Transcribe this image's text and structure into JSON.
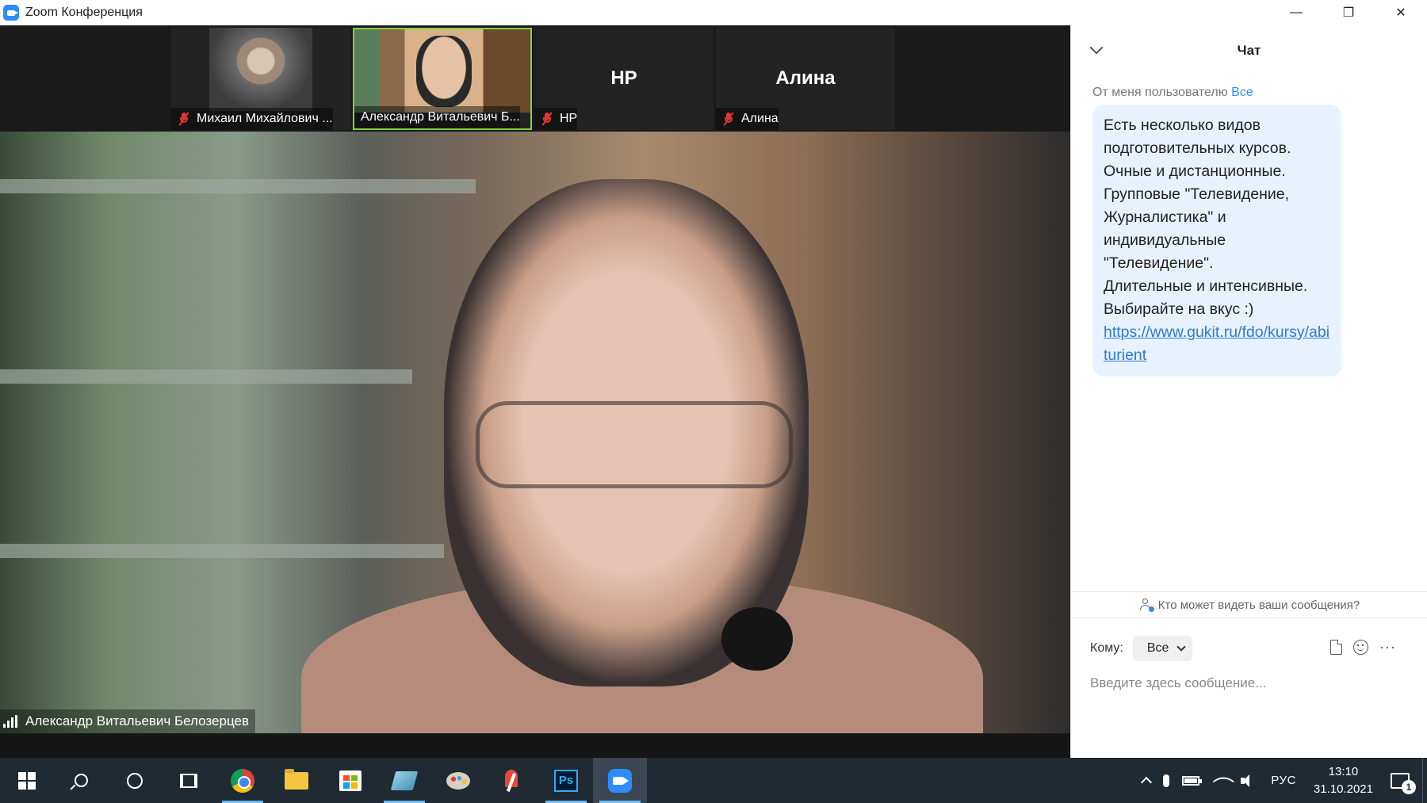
{
  "window": {
    "title": "Zoom Конференция",
    "controls": {
      "minimize": "—",
      "restore": "❐",
      "close": "✕"
    }
  },
  "colors": {
    "accent": "#2d8cff",
    "active_speaker_border": "#7fd33f",
    "muted_red": "#e03535",
    "link": "#2d7bd6",
    "chat_bubble": "#e8f2ff",
    "taskbar": "#1f2a33"
  },
  "participants": [
    {
      "name": "Михаил Михайлович ...",
      "initials": "",
      "muted": true,
      "has_video": true,
      "active": false
    },
    {
      "name": "Александр Витальевич Б...",
      "initials": "",
      "muted": false,
      "has_video": true,
      "active": true
    },
    {
      "name": "НР",
      "initials": "НР",
      "muted": true,
      "has_video": false,
      "active": false
    },
    {
      "name": "Алина",
      "initials": "Алина",
      "muted": true,
      "has_video": false,
      "active": false
    }
  ],
  "main_video": {
    "speaker_name": "Александр Витальевич Белозерцев"
  },
  "chat": {
    "title": "Чат",
    "message": {
      "meta_prefix": "От меня пользователю",
      "meta_to": "Все",
      "lines": [
        "Есть несколько видов",
        "подготовительных курсов.",
        "Очные и дистанционные.",
        "Групповые \"Телевидение,",
        "Журналистика\" и",
        "индивидуальные",
        "\"Телевидение\".",
        "Длительные и интенсивные.",
        "Выбирайте на вкус :)"
      ],
      "link": "https://www.gukit.ru/fdo/kursy/abiturient"
    },
    "visibility_text": "Кто может видеть ваши сообщения?",
    "to_label": "Кому:",
    "to_selected": "Все",
    "input_placeholder": "Введите здесь сообщение...",
    "more_label": "···"
  },
  "taskbar": {
    "apps": [
      {
        "name": "start",
        "icon": "windows-icon"
      },
      {
        "name": "search",
        "icon": "search-icon"
      },
      {
        "name": "cortana",
        "icon": "cortana-icon"
      },
      {
        "name": "task-view",
        "icon": "task-view-icon"
      },
      {
        "name": "chrome",
        "icon": "chrome-icon"
      },
      {
        "name": "file-explorer",
        "icon": "folder-icon"
      },
      {
        "name": "store",
        "icon": "store-icon"
      },
      {
        "name": "ebook-reader",
        "icon": "book-icon"
      },
      {
        "name": "paint",
        "icon": "paint-icon"
      },
      {
        "name": "snipping-tool",
        "icon": "snip-icon"
      },
      {
        "name": "photoshop",
        "icon": "photoshop-icon",
        "label": "Ps"
      },
      {
        "name": "zoom",
        "icon": "zoom-icon"
      }
    ],
    "tray": {
      "language": "РУС",
      "time": "13:10",
      "date": "31.10.2021",
      "notification_count": "1"
    }
  }
}
